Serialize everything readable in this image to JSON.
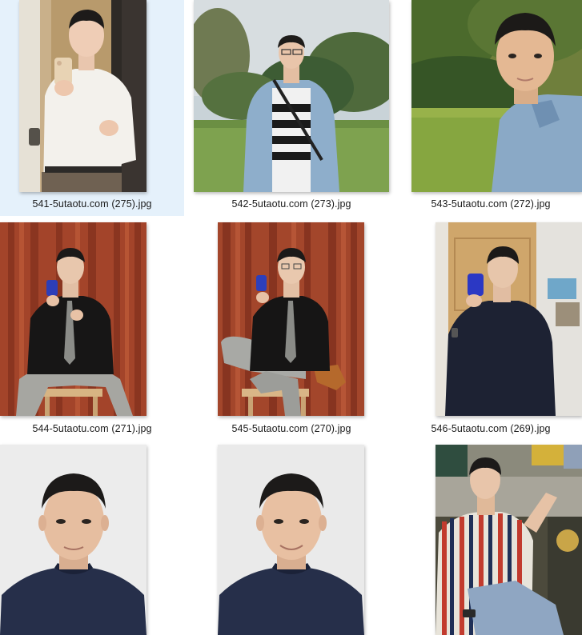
{
  "files": [
    {
      "name": "541-5utaotu.com (275).jpg",
      "selected": true
    },
    {
      "name": "542-5utaotu.com (273).jpg",
      "selected": false
    },
    {
      "name": "543-5utaotu.com (272).jpg",
      "selected": false
    },
    {
      "name": "544-5utaotu.com (271).jpg",
      "selected": false
    },
    {
      "name": "545-5utaotu.com (270).jpg",
      "selected": false
    },
    {
      "name": "546-5utaotu.com (269).jpg",
      "selected": false
    },
    {
      "name": "",
      "selected": false
    },
    {
      "name": "",
      "selected": false
    },
    {
      "name": "",
      "selected": false
    }
  ],
  "colors": {
    "selection": "#e5f1fb",
    "caption_text": "#1a1a1a"
  }
}
